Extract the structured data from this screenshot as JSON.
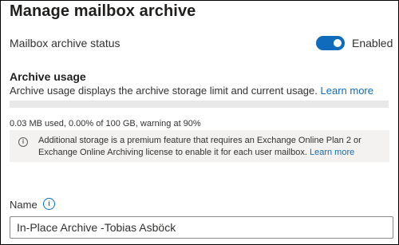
{
  "title": "Manage mailbox archive",
  "archive_status": {
    "label": "Mailbox archive status",
    "toggle_on": true,
    "state_text": "Enabled"
  },
  "usage": {
    "heading": "Archive usage",
    "description": "Archive usage displays the archive storage limit and current usage.",
    "learn_more": "Learn more",
    "percent_used": 0.0,
    "stat": "0.03 MB used, 0.00% of 100 GB, warning at 90%"
  },
  "info": {
    "icon": "info-icon",
    "text": "Additional storage is a premium feature that requires an Exchange Online Plan 2 or Exchange Online Archiving license to enable it for each user mailbox.",
    "learn_more": "Learn more"
  },
  "name_field": {
    "label": "Name",
    "info_icon": "info-icon",
    "value": "In-Place Archive -Tobias Asböck"
  },
  "colors": {
    "accent": "#0f6cbd",
    "info_background": "#f3f2f1"
  }
}
